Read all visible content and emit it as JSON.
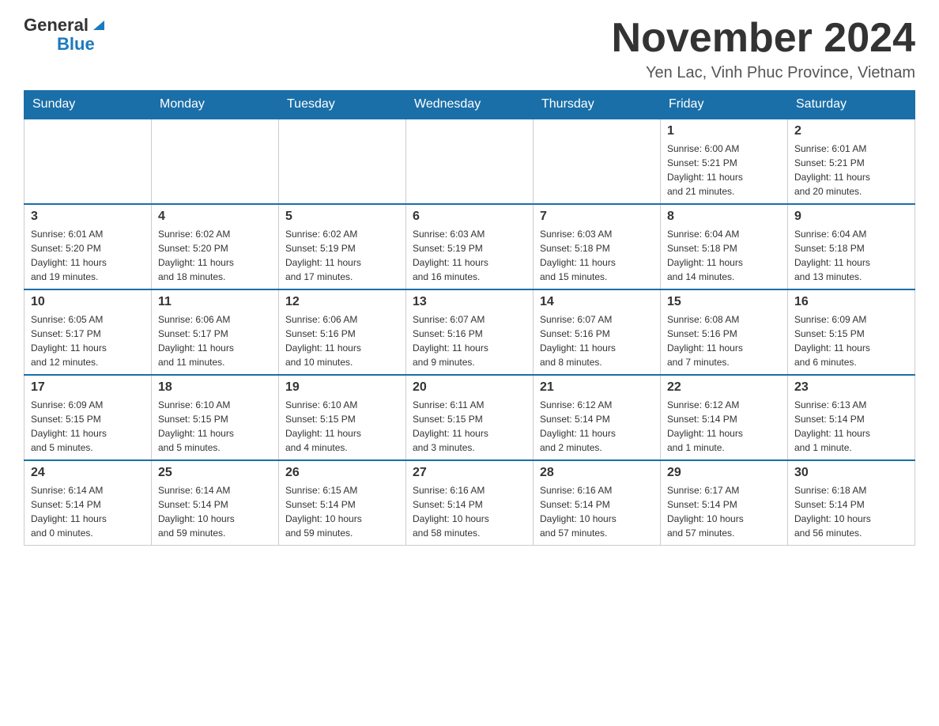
{
  "header": {
    "logo_general": "General",
    "logo_blue": "Blue",
    "month_title": "November 2024",
    "location": "Yen Lac, Vinh Phuc Province, Vietnam"
  },
  "weekdays": [
    "Sunday",
    "Monday",
    "Tuesday",
    "Wednesday",
    "Thursday",
    "Friday",
    "Saturday"
  ],
  "weeks": [
    [
      {
        "day": "",
        "info": ""
      },
      {
        "day": "",
        "info": ""
      },
      {
        "day": "",
        "info": ""
      },
      {
        "day": "",
        "info": ""
      },
      {
        "day": "",
        "info": ""
      },
      {
        "day": "1",
        "info": "Sunrise: 6:00 AM\nSunset: 5:21 PM\nDaylight: 11 hours\nand 21 minutes."
      },
      {
        "day": "2",
        "info": "Sunrise: 6:01 AM\nSunset: 5:21 PM\nDaylight: 11 hours\nand 20 minutes."
      }
    ],
    [
      {
        "day": "3",
        "info": "Sunrise: 6:01 AM\nSunset: 5:20 PM\nDaylight: 11 hours\nand 19 minutes."
      },
      {
        "day": "4",
        "info": "Sunrise: 6:02 AM\nSunset: 5:20 PM\nDaylight: 11 hours\nand 18 minutes."
      },
      {
        "day": "5",
        "info": "Sunrise: 6:02 AM\nSunset: 5:19 PM\nDaylight: 11 hours\nand 17 minutes."
      },
      {
        "day": "6",
        "info": "Sunrise: 6:03 AM\nSunset: 5:19 PM\nDaylight: 11 hours\nand 16 minutes."
      },
      {
        "day": "7",
        "info": "Sunrise: 6:03 AM\nSunset: 5:18 PM\nDaylight: 11 hours\nand 15 minutes."
      },
      {
        "day": "8",
        "info": "Sunrise: 6:04 AM\nSunset: 5:18 PM\nDaylight: 11 hours\nand 14 minutes."
      },
      {
        "day": "9",
        "info": "Sunrise: 6:04 AM\nSunset: 5:18 PM\nDaylight: 11 hours\nand 13 minutes."
      }
    ],
    [
      {
        "day": "10",
        "info": "Sunrise: 6:05 AM\nSunset: 5:17 PM\nDaylight: 11 hours\nand 12 minutes."
      },
      {
        "day": "11",
        "info": "Sunrise: 6:06 AM\nSunset: 5:17 PM\nDaylight: 11 hours\nand 11 minutes."
      },
      {
        "day": "12",
        "info": "Sunrise: 6:06 AM\nSunset: 5:16 PM\nDaylight: 11 hours\nand 10 minutes."
      },
      {
        "day": "13",
        "info": "Sunrise: 6:07 AM\nSunset: 5:16 PM\nDaylight: 11 hours\nand 9 minutes."
      },
      {
        "day": "14",
        "info": "Sunrise: 6:07 AM\nSunset: 5:16 PM\nDaylight: 11 hours\nand 8 minutes."
      },
      {
        "day": "15",
        "info": "Sunrise: 6:08 AM\nSunset: 5:16 PM\nDaylight: 11 hours\nand 7 minutes."
      },
      {
        "day": "16",
        "info": "Sunrise: 6:09 AM\nSunset: 5:15 PM\nDaylight: 11 hours\nand 6 minutes."
      }
    ],
    [
      {
        "day": "17",
        "info": "Sunrise: 6:09 AM\nSunset: 5:15 PM\nDaylight: 11 hours\nand 5 minutes."
      },
      {
        "day": "18",
        "info": "Sunrise: 6:10 AM\nSunset: 5:15 PM\nDaylight: 11 hours\nand 5 minutes."
      },
      {
        "day": "19",
        "info": "Sunrise: 6:10 AM\nSunset: 5:15 PM\nDaylight: 11 hours\nand 4 minutes."
      },
      {
        "day": "20",
        "info": "Sunrise: 6:11 AM\nSunset: 5:15 PM\nDaylight: 11 hours\nand 3 minutes."
      },
      {
        "day": "21",
        "info": "Sunrise: 6:12 AM\nSunset: 5:14 PM\nDaylight: 11 hours\nand 2 minutes."
      },
      {
        "day": "22",
        "info": "Sunrise: 6:12 AM\nSunset: 5:14 PM\nDaylight: 11 hours\nand 1 minute."
      },
      {
        "day": "23",
        "info": "Sunrise: 6:13 AM\nSunset: 5:14 PM\nDaylight: 11 hours\nand 1 minute."
      }
    ],
    [
      {
        "day": "24",
        "info": "Sunrise: 6:14 AM\nSunset: 5:14 PM\nDaylight: 11 hours\nand 0 minutes."
      },
      {
        "day": "25",
        "info": "Sunrise: 6:14 AM\nSunset: 5:14 PM\nDaylight: 10 hours\nand 59 minutes."
      },
      {
        "day": "26",
        "info": "Sunrise: 6:15 AM\nSunset: 5:14 PM\nDaylight: 10 hours\nand 59 minutes."
      },
      {
        "day": "27",
        "info": "Sunrise: 6:16 AM\nSunset: 5:14 PM\nDaylight: 10 hours\nand 58 minutes."
      },
      {
        "day": "28",
        "info": "Sunrise: 6:16 AM\nSunset: 5:14 PM\nDaylight: 10 hours\nand 57 minutes."
      },
      {
        "day": "29",
        "info": "Sunrise: 6:17 AM\nSunset: 5:14 PM\nDaylight: 10 hours\nand 57 minutes."
      },
      {
        "day": "30",
        "info": "Sunrise: 6:18 AM\nSunset: 5:14 PM\nDaylight: 10 hours\nand 56 minutes."
      }
    ]
  ]
}
